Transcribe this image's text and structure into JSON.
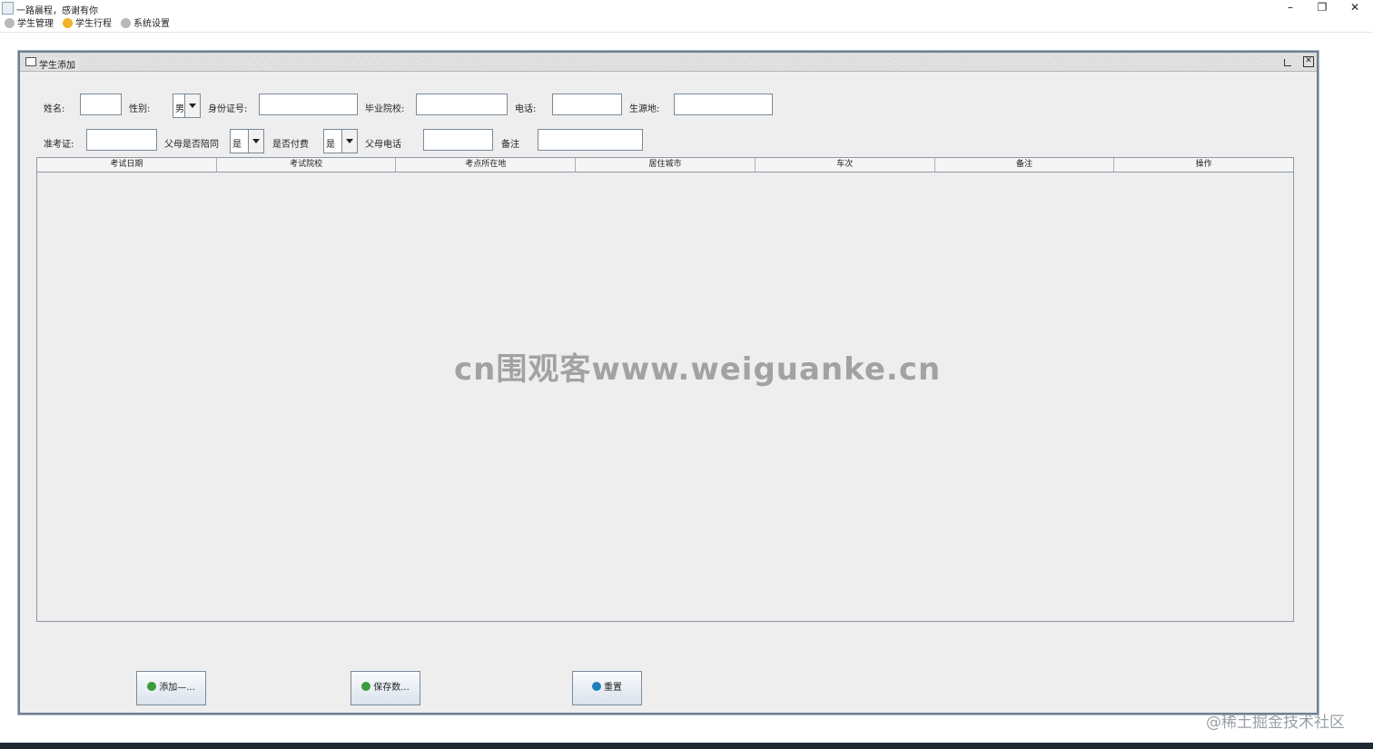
{
  "window": {
    "title": "一路晨程，感谢有你",
    "controls": {
      "minimize": "–",
      "restore": "❐",
      "close": "✕"
    }
  },
  "menu": [
    {
      "label": "学生管理",
      "icon": "gear-icon",
      "color": "#b9b9b9"
    },
    {
      "label": "学生行程",
      "icon": "star-icon",
      "color": "#f0b429"
    },
    {
      "label": "系统设置",
      "icon": "gear-icon",
      "color": "#b9b9b9"
    }
  ],
  "internal_frame": {
    "title": "学生添加"
  },
  "form": {
    "row1": {
      "name_label": "姓名:",
      "gender_label": "性别:",
      "gender_value": "男",
      "id_label": "身份证号:",
      "school_label": "毕业院校:",
      "phone_label": "电话:",
      "origin_label": "生源地:"
    },
    "row2": {
      "ticket_label": "准考证:",
      "parent_accompany_label": "父母是否陪同",
      "parent_accompany_value": "是",
      "paid_label": "是否付费",
      "paid_value": "是",
      "parent_phone_label": "父母电话",
      "remark_label": "备注"
    }
  },
  "table": {
    "columns": [
      "考试日期",
      "考试院校",
      "考点所在地",
      "居住城市",
      "车次",
      "备注",
      "操作"
    ],
    "rows": []
  },
  "buttons": {
    "add": "添加—...",
    "save": "保存数...",
    "reset": "重置"
  },
  "colors": {
    "add_icon": "#3a9d3a",
    "save_icon": "#3a9d3a",
    "reset_icon": "#1f7fbf"
  },
  "overlays": {
    "watermark": "cn围观客www.weiguanke.cn",
    "credit": "@稀土掘金技术社区"
  }
}
